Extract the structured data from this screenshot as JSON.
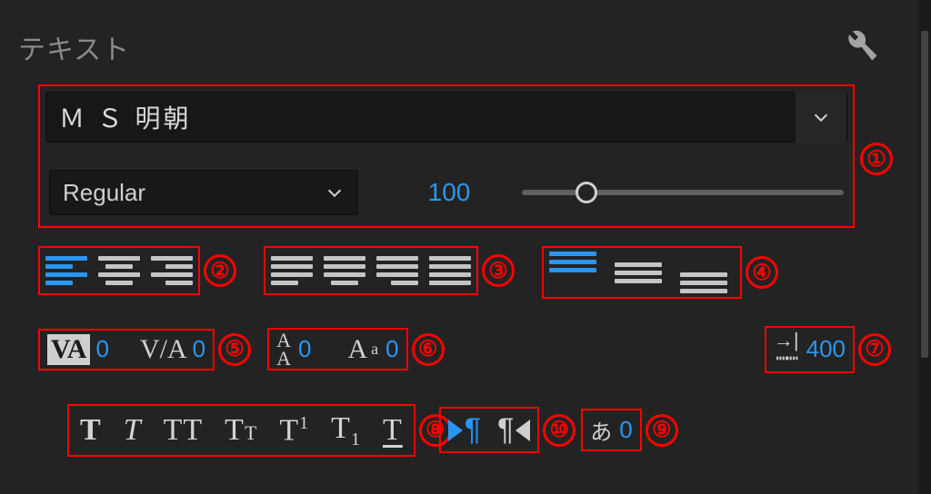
{
  "header": {
    "title": "テキスト"
  },
  "font": {
    "family": "Ｍ Ｓ 明朝",
    "style": "Regular",
    "size": "100"
  },
  "tracking": {
    "value": "0"
  },
  "kerning": {
    "value": "0"
  },
  "leading": {
    "value": "0"
  },
  "baseline_shift": {
    "value": "0"
  },
  "tab_width": {
    "value": "400"
  },
  "tsume": {
    "value": "0"
  },
  "annotations": {
    "b1": "①",
    "b2": "②",
    "b3": "③",
    "b4": "④",
    "b5": "⑤",
    "b6": "⑥",
    "b7": "⑦",
    "b8": "⑧",
    "b9": "⑨",
    "b10": "⑩"
  }
}
